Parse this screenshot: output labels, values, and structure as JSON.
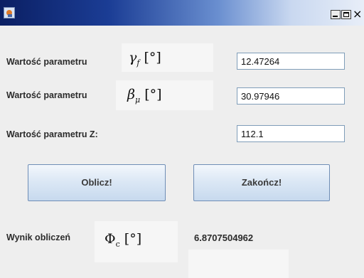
{
  "window": {
    "title": ""
  },
  "rows": [
    {
      "label": "Wartość parametru",
      "symbol_main": "γ",
      "symbol_sub": "f",
      "unit": "[°]",
      "value": "12.47264"
    },
    {
      "label": "Wartość parametru",
      "symbol_main": "β",
      "symbol_sub": "μ",
      "unit": "[°]",
      "value": "30.97946"
    },
    {
      "label": "Wartość parametru Z:",
      "value": "112.1"
    }
  ],
  "buttons": {
    "calculate": "Oblicz!",
    "exit": "Zakończ!"
  },
  "result": {
    "label": "Wynik obliczeń",
    "symbol_main": "Φ",
    "symbol_sub": "c",
    "unit": "[°]",
    "value": "6.8707504962"
  },
  "colors": {
    "titlebar_start": "#0b1f63",
    "titlebar_end": "#e8eef8",
    "field_border": "#7f9db9",
    "button_border": "#6f8eb6"
  },
  "icons": [
    "java-app-icon",
    "minimize-icon",
    "maximize-icon",
    "close-icon"
  ]
}
